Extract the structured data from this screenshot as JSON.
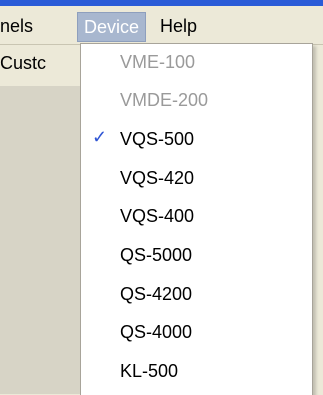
{
  "menubar": {
    "items": [
      "nels",
      "Device",
      "Help"
    ]
  },
  "toolbar": {
    "left_text": "Custc"
  },
  "dropdown": {
    "items": [
      {
        "label": "VME-100",
        "enabled": false,
        "checked": false
      },
      {
        "label": "VMDE-200",
        "enabled": false,
        "checked": false
      },
      {
        "label": "VQS-500",
        "enabled": true,
        "checked": true
      },
      {
        "label": "VQS-420",
        "enabled": true,
        "checked": false
      },
      {
        "label": "VQS-400",
        "enabled": true,
        "checked": false
      },
      {
        "label": "QS-5000",
        "enabled": true,
        "checked": false
      },
      {
        "label": "QS-4200",
        "enabled": true,
        "checked": false
      },
      {
        "label": "QS-4000",
        "enabled": true,
        "checked": false
      },
      {
        "label": "KL-500",
        "enabled": true,
        "checked": false
      }
    ],
    "check_glyph": "✓",
    "check_color": "#2f55d4"
  },
  "colors": {
    "menubar_bg": "#ece9d8",
    "top_accent": "#2a5bd7",
    "device_highlight": "#a8b7cf",
    "disabled_text": "#9a9a9a"
  }
}
